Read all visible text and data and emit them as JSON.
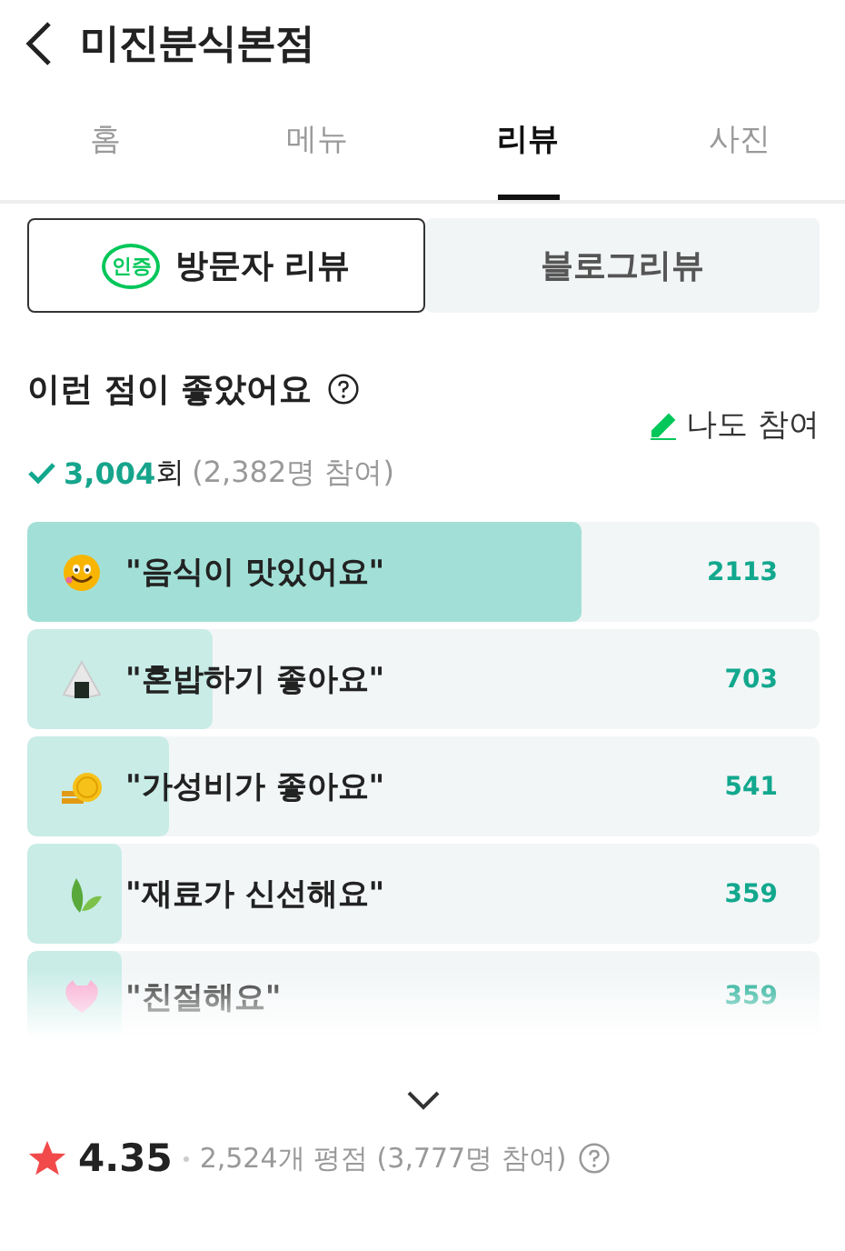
{
  "header": {
    "title": "미진분식본점"
  },
  "tabs": [
    {
      "label": "홈",
      "selected": false
    },
    {
      "label": "메뉴",
      "selected": false
    },
    {
      "label": "리뷰",
      "selected": true
    },
    {
      "label": "사진",
      "selected": false
    }
  ],
  "review_tabs": [
    {
      "label": "방문자 리뷰",
      "badge": "인증",
      "selected": true
    },
    {
      "label": "블로그리뷰",
      "selected": false
    }
  ],
  "section": {
    "title": "이런 점이 좋았어요",
    "join_link": "나도 참여",
    "total": "3,004",
    "total_unit": "회",
    "participants": "(2,382명 참여)"
  },
  "keywords": [
    {
      "kind": "smile",
      "label": "\"음식이 맛있어요\"",
      "count": "2113",
      "level": 0.7,
      "highlighted": true,
      "faded": false
    },
    {
      "kind": "riceball",
      "label": "\"혼밥하기 좋아요\"",
      "count": "703",
      "level": 0.234,
      "highlighted": false,
      "faded": false
    },
    {
      "kind": "coin",
      "label": "\"가성비가 좋아요\"",
      "count": "541",
      "level": 0.18,
      "highlighted": false,
      "faded": false
    },
    {
      "kind": "leaf",
      "label": "\"재료가 신선해요\"",
      "count": "359",
      "level": 0.12,
      "highlighted": false,
      "faded": false
    },
    {
      "kind": "heart",
      "label": "\"친절해요\"",
      "count": "359",
      "level": 0.12,
      "highlighted": false,
      "faded": true
    }
  ],
  "rating": {
    "score": "4.35",
    "summary": "2,524개 평점 (3,777명 참여)"
  }
}
